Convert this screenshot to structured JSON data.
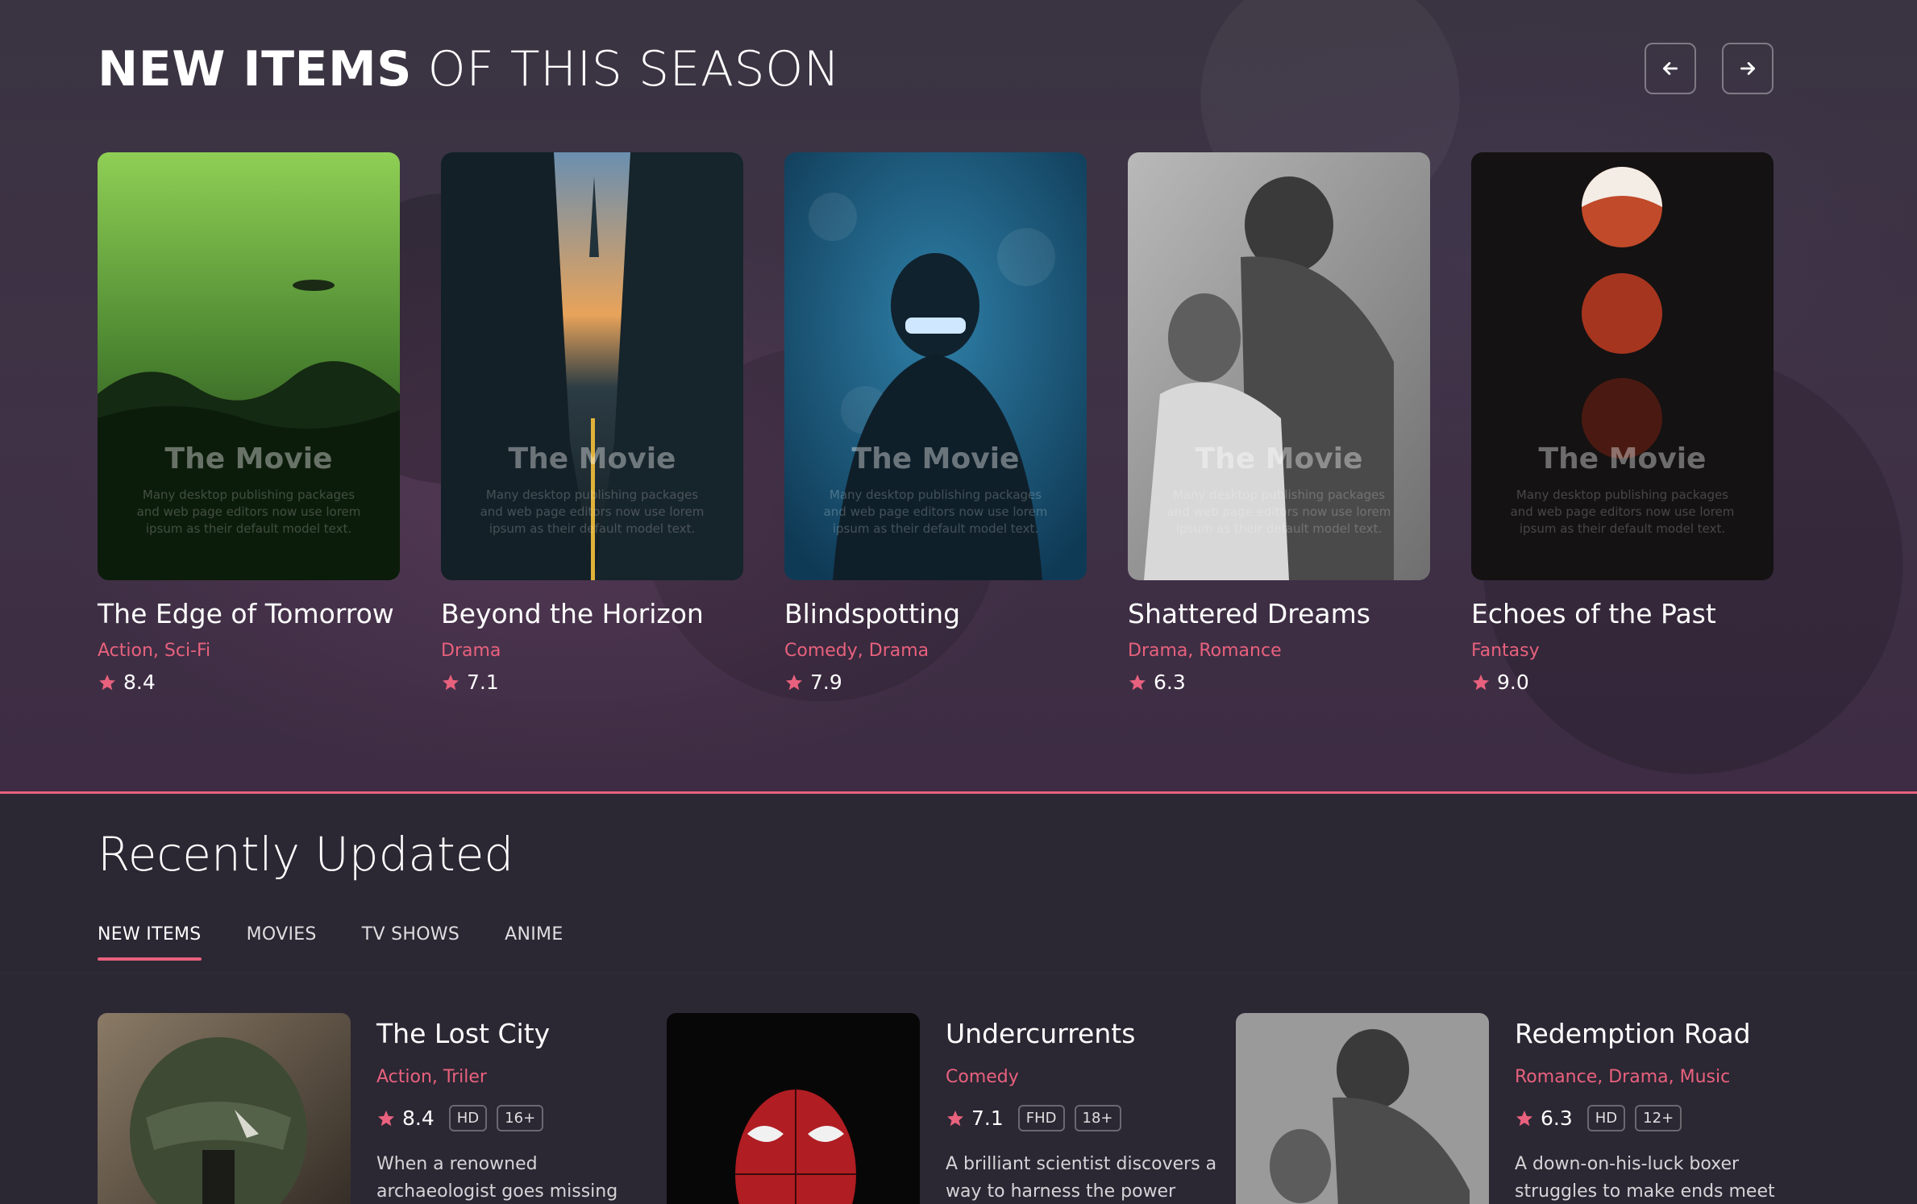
{
  "season_section": {
    "title_bold": "NEW ITEMS",
    "title_rest": " OF THIS SEASON",
    "accent_color": "#e8617d",
    "prev_icon": "arrow-left-icon",
    "next_icon": "arrow-right-icon",
    "poster_overlay": {
      "title": "The Movie",
      "text": "Many desktop publishing packages and web page editors now use lorem ipsum as their default model text."
    },
    "cards": [
      {
        "title": "The Edge of Tomorrow",
        "genres": "Action, Sci-Fi",
        "rating": "8.4"
      },
      {
        "title": "Beyond the Horizon",
        "genres": "Drama",
        "rating": "7.1"
      },
      {
        "title": "Blindspotting",
        "genres": "Comedy, Drama",
        "rating": "7.9"
      },
      {
        "title": "Shattered Dreams",
        "genres": "Drama, Romance",
        "rating": "6.3"
      },
      {
        "title": "Echoes of the Past",
        "genres": "Fantasy",
        "rating": "9.0"
      }
    ]
  },
  "recent_section": {
    "title": "Recently Updated",
    "tabs": [
      "NEW ITEMS",
      "MOVIES",
      "TV SHOWS",
      "ANIME"
    ],
    "active_tab": "NEW ITEMS",
    "items": [
      {
        "title": "The Lost City",
        "genres": "Action, Triler",
        "rating": "8.4",
        "quality": "HD",
        "age": "16+",
        "description": "When a renowned archaeologist goes missing"
      },
      {
        "title": "Undercurrents",
        "genres": "Comedy",
        "rating": "7.1",
        "quality": "FHD",
        "age": "18+",
        "description": "A brilliant scientist discovers a way to harness the power"
      },
      {
        "title": "Redemption Road",
        "genres": "Romance, Drama, Music",
        "rating": "6.3",
        "quality": "HD",
        "age": "12+",
        "description": "A down-on-his-luck boxer struggles to make ends meet"
      }
    ]
  }
}
